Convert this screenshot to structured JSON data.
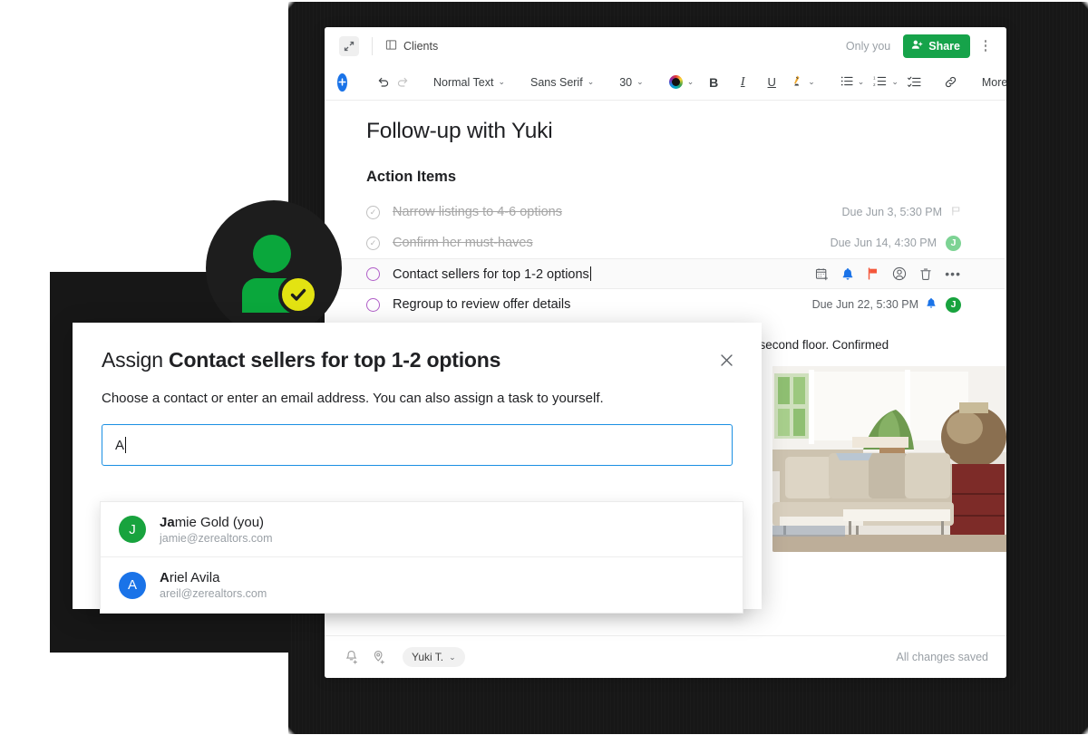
{
  "doc_header": {
    "expand_icon": "expand-icon",
    "breadcrumb_icon": "doc-panel-icon",
    "breadcrumb": "Clients",
    "only_you": "Only you",
    "share_label": "Share",
    "share_icon": "person-add-icon",
    "share_color": "#16a34a",
    "kebab_icon": "more-vertical-icon"
  },
  "toolbar": {
    "add_label": "+",
    "undo_icon": "undo-icon",
    "redo_icon": "redo-icon",
    "style_label": "Normal Text",
    "font_label": "Sans Serif",
    "size_label": "30",
    "color_label": "color-picker",
    "bold_label": "B",
    "italic_label": "I",
    "underline_label": "U",
    "highlight_label": "highlight",
    "bullets_icon": "bulleted-list-icon",
    "numbered_icon": "numbered-list-icon",
    "checklist_icon": "checklist-icon",
    "link_icon": "link-icon",
    "more_label": "More"
  },
  "document": {
    "title": "Follow-up with Yuki",
    "section_heading": "Action Items",
    "tasks": [
      {
        "text": "Narrow listings to 4-6 options",
        "done": true,
        "due": "Due Jun 3, 5:30 PM",
        "assignee": "",
        "trailing_icon": "flag-outline-icon"
      },
      {
        "text": "Confirm her must-haves",
        "done": true,
        "due": "Due Jun 14, 4:30 PM",
        "assignee": "J",
        "assignee_color": "#7dd394"
      },
      {
        "text": "Contact sellers for top 1-2 options",
        "done": false,
        "active": true,
        "due": "",
        "row_icons": [
          "calendar-add-icon",
          "bell-icon",
          "flag-icon",
          "assign-person-icon",
          "trash-icon",
          "more-horizontal-icon"
        ]
      },
      {
        "text": "Regroup to review offer details",
        "done": false,
        "due": "Due Jun 22, 5:30 PM",
        "reminder_icon": "bell-icon",
        "assignee": "J",
        "assignee_color": "#18a33e"
      }
    ],
    "note_fragment": "in on the second floor. Confirmed",
    "photo_alt": "living-room-photo"
  },
  "doc_footer": {
    "reminder_icon": "add-reminder-icon",
    "location_icon": "add-location-icon",
    "chip_label": "Yuki T.",
    "chip_caret": "⌄",
    "status": "All changes saved"
  },
  "assign_badge": {
    "icon": "assign-person-check-badge",
    "circle_color": "#1d1d1d",
    "person_color": "#0aa73c",
    "check_color": "#e3e312"
  },
  "modal": {
    "title_prefix": "Assign ",
    "title_task": "Contact sellers for top 1-2 options",
    "close_icon": "close-icon",
    "description": "Choose a contact or enter an email address. You can also assign a task to yourself.",
    "input_value": "A",
    "input_focus_color": "#1a8fe3",
    "suggestions": [
      {
        "initial": "J",
        "avatar_color": "#18a33e",
        "match": "Ja",
        "name_rest": "mie Gold (you)",
        "email": "jamie@zerealtors.com"
      },
      {
        "initial": "A",
        "avatar_color": "#1a73e8",
        "match": "A",
        "name_rest": "riel Avila",
        "email": "areil@zerealtors.com"
      }
    ]
  }
}
